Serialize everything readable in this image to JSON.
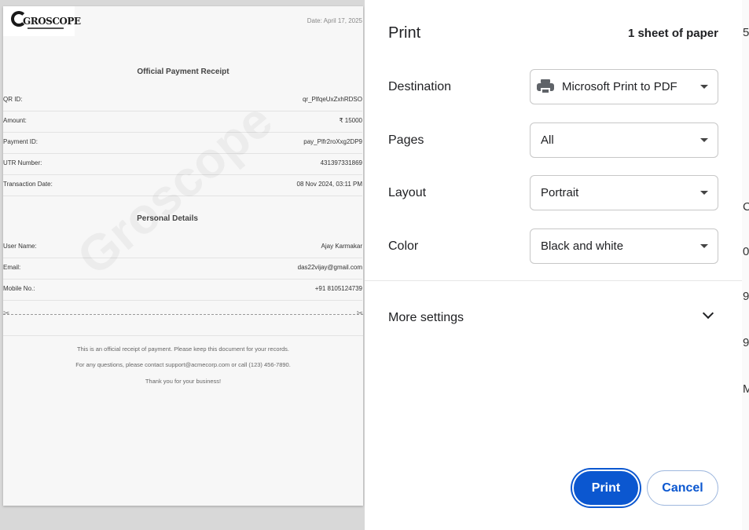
{
  "receipt": {
    "logo_text": "GROSCOPE",
    "date": "Date: April 17, 2025",
    "section_title": "Official Payment Receipt",
    "rows": [
      {
        "label": "QR ID:",
        "value": "qr_PlfqeUxZxhRDSO"
      },
      {
        "label": "Amount:",
        "value": "₹ 15000"
      },
      {
        "label": "Payment ID:",
        "value": "pay_Plfr2roXxg2DP9"
      },
      {
        "label": "UTR Number:",
        "value": "431397331869"
      },
      {
        "label": "Transaction Date:",
        "value": "08 Nov 2024, 03:11 PM"
      }
    ],
    "personal_title": "Personal Details",
    "personal_rows": [
      {
        "label": "User Name:",
        "value": "Ajay Karmakar"
      },
      {
        "label": "Email:",
        "value": "das22vijay@gmail.com"
      },
      {
        "label": "Mobile No.:",
        "value": "+91 8105124739"
      }
    ],
    "watermark": "Groscope",
    "footer": [
      "This is an official receipt of payment. Please keep this document for your records.",
      "For any questions, please contact support@acmecorp.com or call (123) 456-7890.",
      "Thank you for your business!"
    ]
  },
  "dialog": {
    "title": "Print",
    "sheets": "1 sheet of paper",
    "destination": {
      "label": "Destination",
      "value": "Microsoft Print to PDF"
    },
    "pages": {
      "label": "Pages",
      "value": "All"
    },
    "layout": {
      "label": "Layout",
      "value": "Portrait"
    },
    "color": {
      "label": "Color",
      "value": "Black and white"
    },
    "more_settings": "More settings",
    "print_button": "Print",
    "cancel_button": "Cancel"
  },
  "background_strip": [
    "5",
    "C",
    "0",
    "9",
    "9",
    "M"
  ]
}
